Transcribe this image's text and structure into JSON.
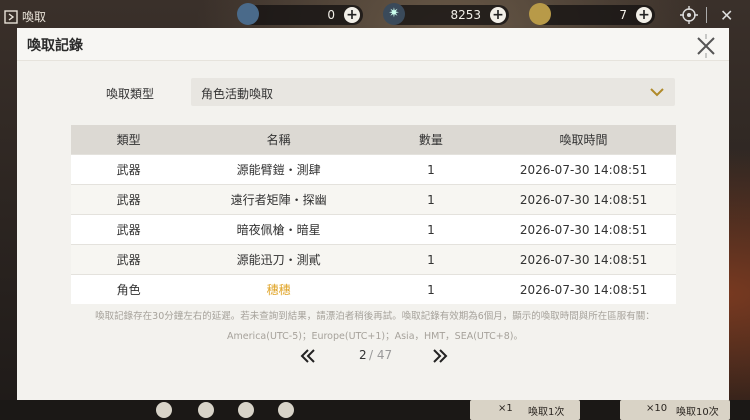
{
  "topbar": {
    "title": "喚取",
    "resources": [
      {
        "icon": "cd-currency-icon",
        "value": "0"
      },
      {
        "icon": "star-currency-icon",
        "value": "8253"
      },
      {
        "icon": "coin-currency-icon",
        "value": "7"
      }
    ]
  },
  "modal": {
    "title": "喚取記錄",
    "filter_label": "喚取類型",
    "filter_value": "角色活動喚取",
    "columns": [
      "類型",
      "名稱",
      "數量",
      "喚取時間"
    ],
    "rows": [
      {
        "type": "武器",
        "name": "源能臂鎧・測肆",
        "count": "1",
        "time": "2026-07-30 14:08:51",
        "highlight": false
      },
      {
        "type": "武器",
        "name": "遠行者矩陣・探幽",
        "count": "1",
        "time": "2026-07-30 14:08:51",
        "highlight": false
      },
      {
        "type": "武器",
        "name": "暗夜佩槍・暗星",
        "count": "1",
        "time": "2026-07-30 14:08:51",
        "highlight": false
      },
      {
        "type": "武器",
        "name": "源能迅刀・測貳",
        "count": "1",
        "time": "2026-07-30 14:08:51",
        "highlight": false
      },
      {
        "type": "角色",
        "name": "穗穗",
        "count": "1",
        "time": "2026-07-30 14:08:51",
        "highlight": true
      }
    ],
    "notice_line1": "喚取記錄存在30分鐘左右的延遲。若未查詢到結果，請漂泊者稍後再試。喚取記錄有效期為6個月，顯示的喚取時間與所在區服有關：",
    "notice_line2": "America(UTC-5)；Europe(UTC+1)；Asia，HMT，SEA(UTC+8)。",
    "pager": {
      "current": "2",
      "total": "/ 47"
    }
  },
  "bottom": {
    "pull1_count": "×1",
    "pull1_label": "喚取1次",
    "pull10_count": "×10",
    "pull10_label": "喚取10次"
  },
  "colors": {
    "highlight": "#e0a52a",
    "accent": "#c9a030"
  }
}
